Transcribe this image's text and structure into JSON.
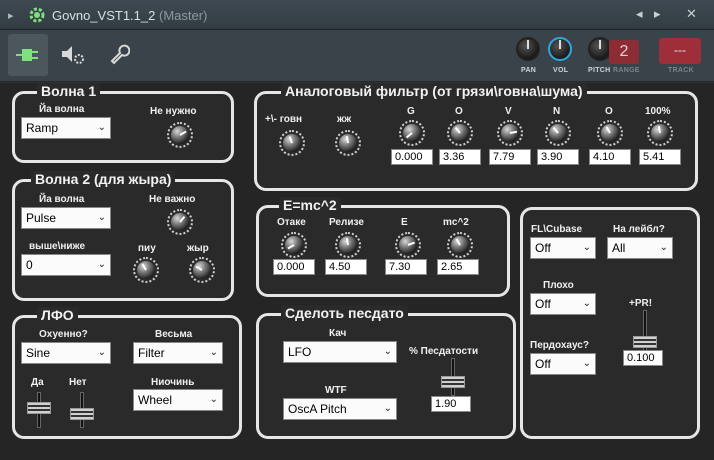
{
  "window": {
    "title": "Govno_VST1.1_2",
    "subtitle": "(Master)",
    "prev": "◂",
    "next": "▸",
    "close": "✕",
    "arrow": "▸"
  },
  "toolbar": {
    "pan_label": "PAN",
    "vol_label": "VOL",
    "pitch_label": "PITCH",
    "range_label": "RANGE",
    "range_value": "2",
    "track_label": "TRACK",
    "track_value": "---"
  },
  "wave1": {
    "title": "Волна 1",
    "wave_label": "Йа волна",
    "wave_value": "Ramp",
    "knob_label": "Не нужно"
  },
  "wave2": {
    "title": "Волна 2 (для жыра)",
    "wave_label": "Йа волна",
    "wave_value": "Pulse",
    "knob_label": "Не важно",
    "octave_label": "выше\\ниже",
    "octave_value": "0",
    "piu_label": "пиу",
    "fat_label": "жыр"
  },
  "lfo": {
    "title": "ЛФО",
    "awesome_label": "Охуенно?",
    "awesome_value": "Sine",
    "very_label": "Весьма",
    "very_value": "Filter",
    "nothing_label": "Ниочинь",
    "nothing_value": "Wheel",
    "yes_label": "Да",
    "no_label": "Нет"
  },
  "filter": {
    "title": "Аналоговый фильтр (от грязи\\говна\\шума)",
    "k1_label": "+\\- говн",
    "k2_label": "жж",
    "knobs": [
      {
        "label": "G",
        "value": "0.000"
      },
      {
        "label": "O",
        "value": "3.36"
      },
      {
        "label": "V",
        "value": "7.79"
      },
      {
        "label": "N",
        "value": "3.90"
      },
      {
        "label": "O",
        "value": "4.10"
      },
      {
        "label": "100%",
        "value": "5.41"
      }
    ]
  },
  "emc": {
    "title": "E=mc^2",
    "knobs": [
      {
        "label": "Отаке",
        "value": "0.000"
      },
      {
        "label": "Релизе",
        "value": "4.50"
      },
      {
        "label": "E",
        "value": "7.30"
      },
      {
        "label": "mc^2",
        "value": "2.65"
      }
    ]
  },
  "pesdato": {
    "title": "Сделоть песдато",
    "kach_label": "Кач",
    "kach_value": "LFO",
    "wtf_label": "WTF",
    "wtf_value": "OscA Pitch",
    "percent_label": "% Песдатости",
    "percent_value": "1.90"
  },
  "right": {
    "fl_label": "FL\\Cubase",
    "fl_value": "Off",
    "label_label": "На лейбл?",
    "label_value": "All",
    "bad_label": "Плохо",
    "bad_value": "Off",
    "perd_label": "Пердохаус?",
    "perd_value": "Off",
    "pr_label": "+PR!",
    "pr_value": "0.100"
  },
  "colors": {
    "accent_vol": "#2fa8e0",
    "track_red": "#9e2f38",
    "icon_green": "#7fe07f"
  }
}
